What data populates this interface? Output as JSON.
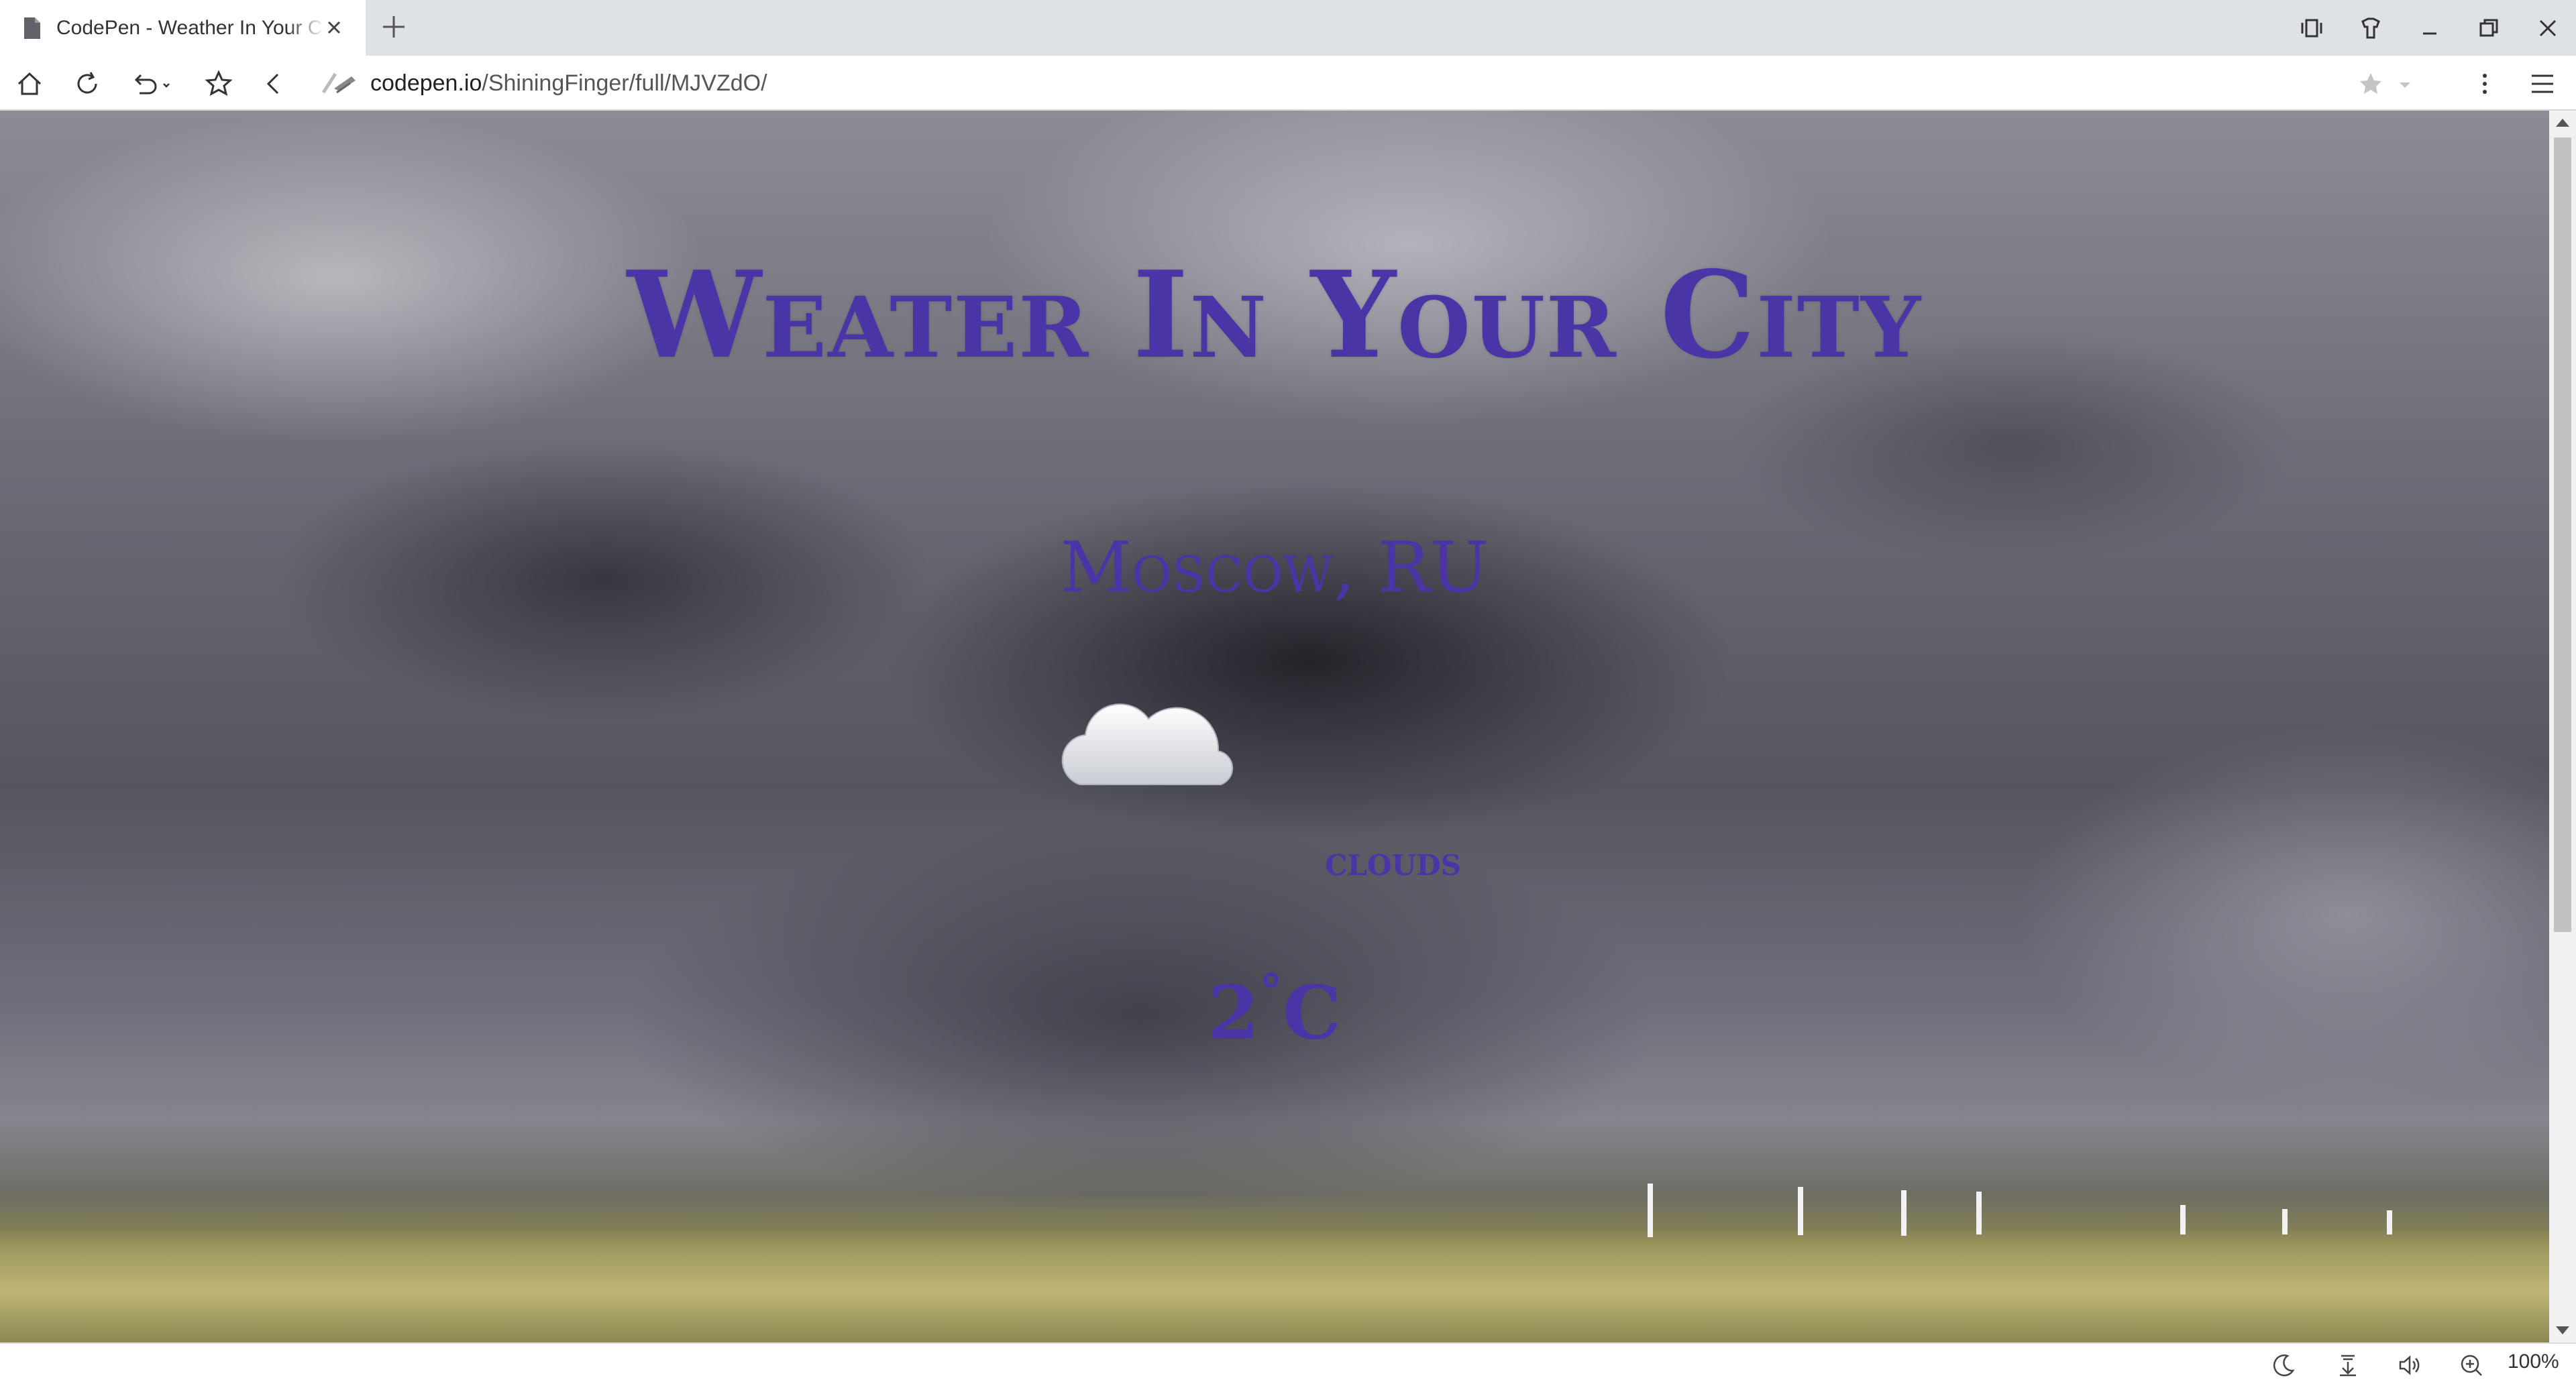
{
  "browser": {
    "tab_title": "CodePen - Weather In Your City",
    "url_host": "codepen.io",
    "url_path": "/ShiningFinger/full/MJVZdO/",
    "zoom": "100%"
  },
  "page": {
    "title": "Weater In Your City",
    "city": "Moscow, RU",
    "weather_icon": "cloud-icon",
    "description": "clouds",
    "temperature": "2",
    "degree_symbol": "°",
    "unit": "C"
  },
  "colors": {
    "heading": "#4b34a6",
    "tabbar_bg": "#dee1e6"
  }
}
